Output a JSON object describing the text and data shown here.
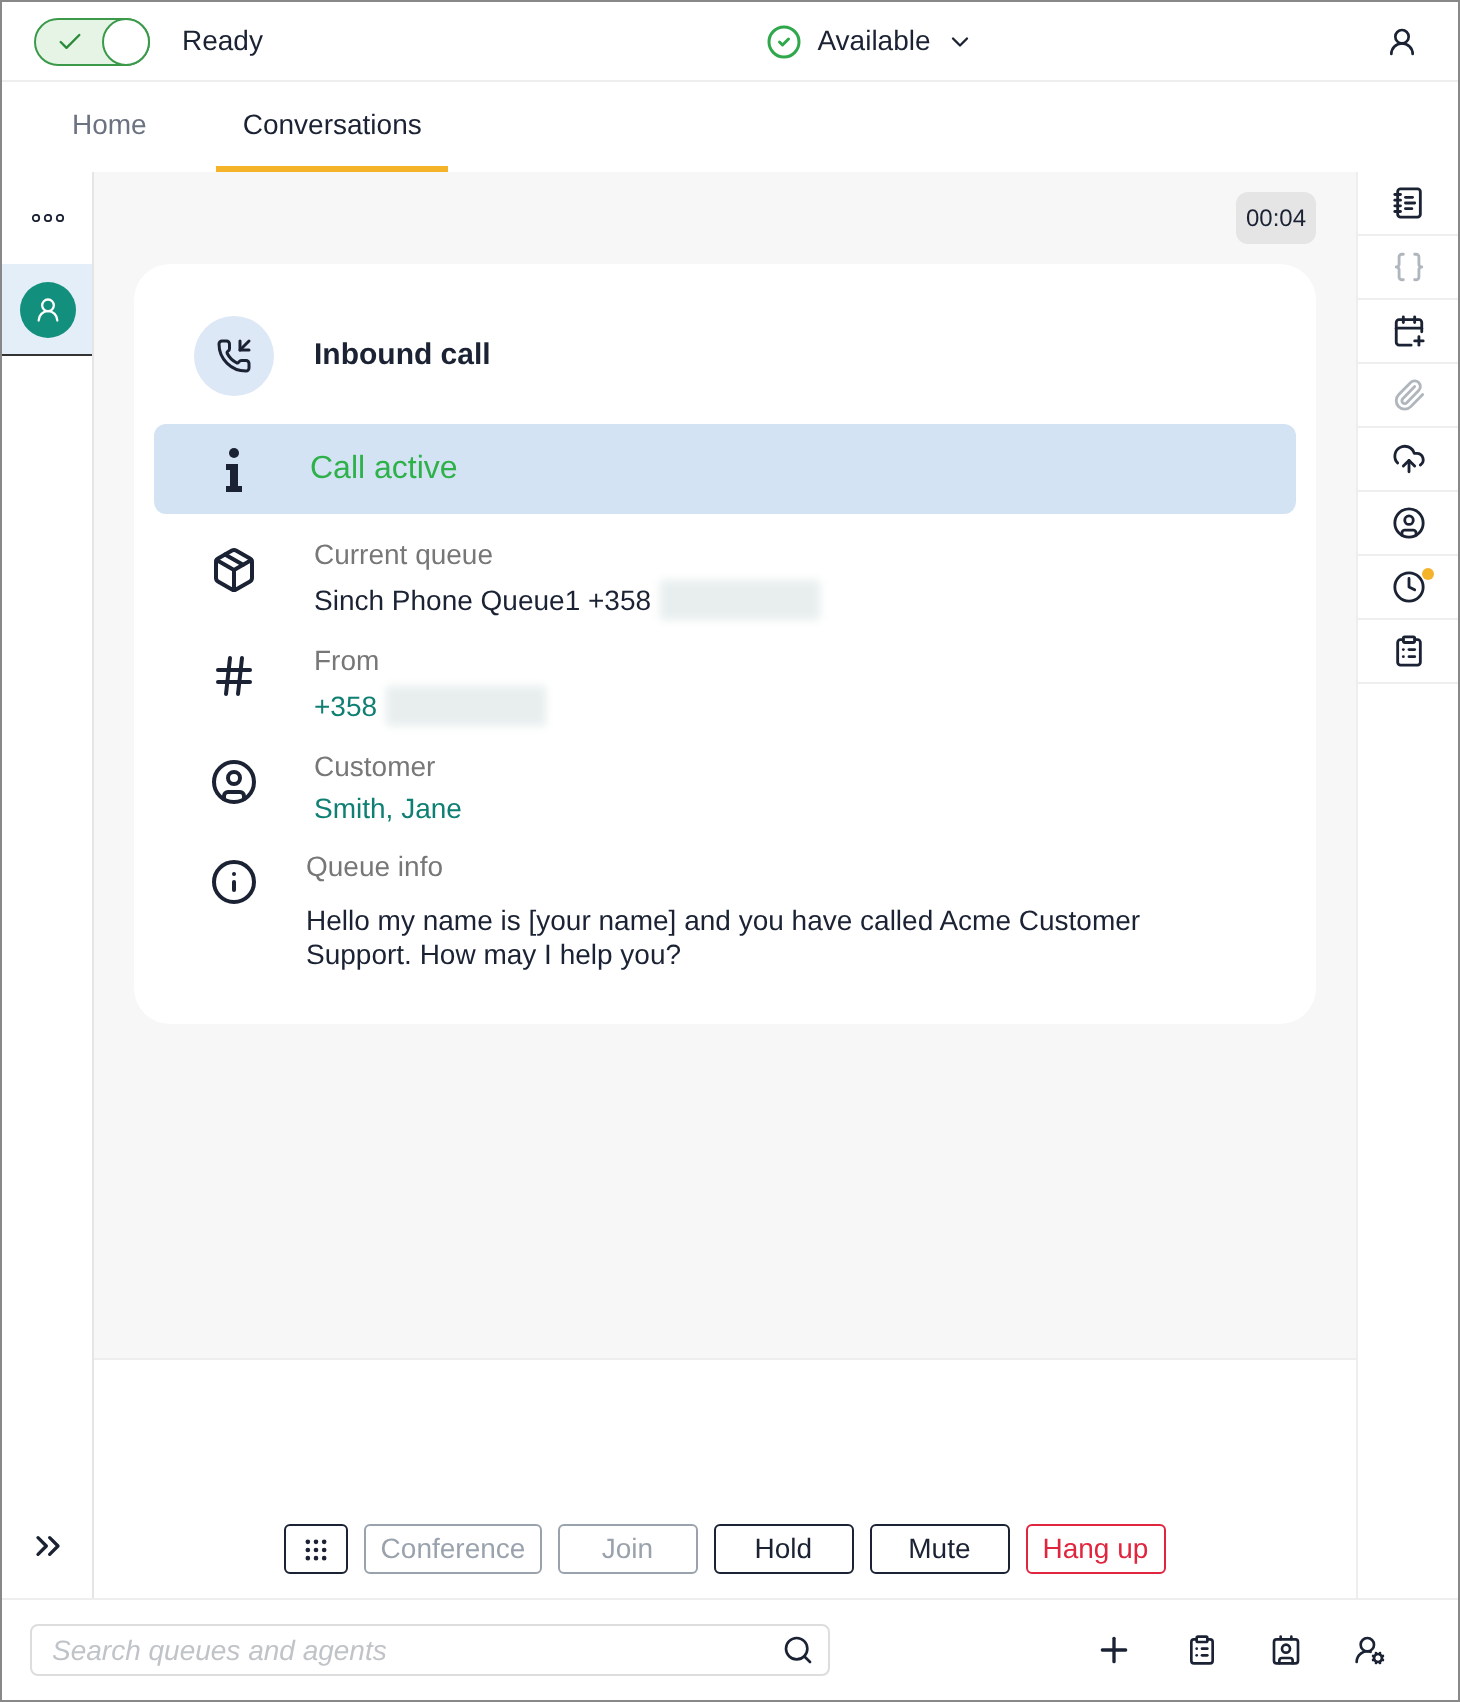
{
  "top_bar": {
    "toggle": {
      "on": true
    },
    "status_label": "Ready",
    "availability": "Available"
  },
  "tabs": [
    {
      "label": "Home",
      "selected": false
    },
    {
      "label": "Conversations",
      "selected": true
    }
  ],
  "left_rail": {
    "items": [
      {
        "selected": false
      },
      {
        "selected": true
      }
    ]
  },
  "timer": "00:04",
  "card": {
    "title": "Inbound call",
    "banner": "Call active",
    "fields": [
      {
        "label": "Current queue",
        "value": "Sinch Phone Queue1 +358",
        "link": false,
        "redacted": true
      },
      {
        "label": "From",
        "value": "+358",
        "link": true,
        "redacted": true
      },
      {
        "label": "Customer",
        "value": "Smith, Jane",
        "link": true,
        "redacted": false
      },
      {
        "label": "Queue info",
        "value": "Hello my name is [your name] and you have called Acme Customer Support. How may I help you?",
        "link": false,
        "redacted": false
      }
    ]
  },
  "right_rail": [
    {
      "disabled": false,
      "badge": false
    },
    {
      "disabled": true,
      "badge": false
    },
    {
      "disabled": false,
      "badge": false
    },
    {
      "disabled": true,
      "badge": false
    },
    {
      "disabled": false,
      "badge": false
    },
    {
      "disabled": false,
      "badge": false
    },
    {
      "disabled": false,
      "badge": true
    },
    {
      "disabled": false,
      "badge": false
    }
  ],
  "call_buttons": [
    {
      "kind": "dialpad",
      "disabled": false
    },
    {
      "kind": "text",
      "label": "Conference",
      "disabled": true
    },
    {
      "kind": "text",
      "label": "Join",
      "disabled": true
    },
    {
      "kind": "text",
      "label": "Hold",
      "disabled": false
    },
    {
      "kind": "text",
      "label": "Mute",
      "disabled": false
    },
    {
      "kind": "danger",
      "label": "Hang up",
      "disabled": false
    }
  ],
  "search": {
    "placeholder": "Search queues and agents"
  }
}
